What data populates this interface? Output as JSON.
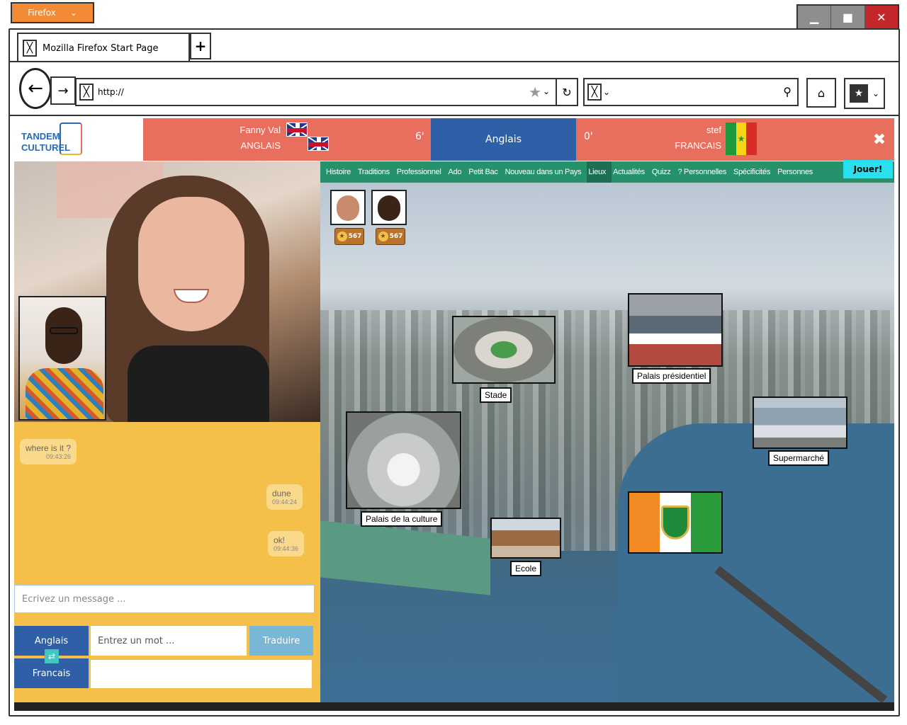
{
  "browser": {
    "menu_button": "Firefox",
    "tab_title": "Mozilla Firefox Start Page",
    "new_tab": "+",
    "url": "http://"
  },
  "header": {
    "logo_line1": "TANDEM",
    "logo_line2": "CULTUREL",
    "user1": {
      "name": "Fanny Val",
      "language": "ANGLAIS"
    },
    "score1": "6'",
    "current_language": "Anglais",
    "score2": "0'",
    "user2": {
      "name": "stef",
      "language": "FRANCAIS"
    },
    "senegal_flag_colors": [
      "#1e9a3c",
      "#f7d417",
      "#d62e27"
    ]
  },
  "chat": {
    "messages": [
      {
        "text": "where is it ?",
        "time": "09:43:26",
        "side": "left"
      },
      {
        "text": "dune",
        "time": "09:44:24",
        "side": "right"
      },
      {
        "text": "ok!",
        "time": "09:44:36",
        "side": "right"
      }
    ],
    "input_placeholder": "Ecrivez un message ...",
    "translate": {
      "source_lang": "Anglais",
      "target_lang": "Francais",
      "word_placeholder": "Entrez un mot ...",
      "button": "Traduire"
    }
  },
  "nav": {
    "items": [
      "Histoire",
      "Traditions",
      "Professionnel",
      "Ado",
      "Petit Bac",
      "Nouveau dans un Pays",
      "Lieux",
      "Actualités",
      "Quizz",
      "? Personnelles",
      "Spécificités",
      "Personnes"
    ],
    "active": "Lieux",
    "play_button": "Jouer!"
  },
  "players": [
    {
      "score": "567"
    },
    {
      "score": "567"
    }
  ],
  "places": [
    {
      "label": "Stade"
    },
    {
      "label": "Palais présidentiel"
    },
    {
      "label": "Supermarché"
    },
    {
      "label": "Palais de la culture"
    },
    {
      "label": "Ecole"
    }
  ]
}
